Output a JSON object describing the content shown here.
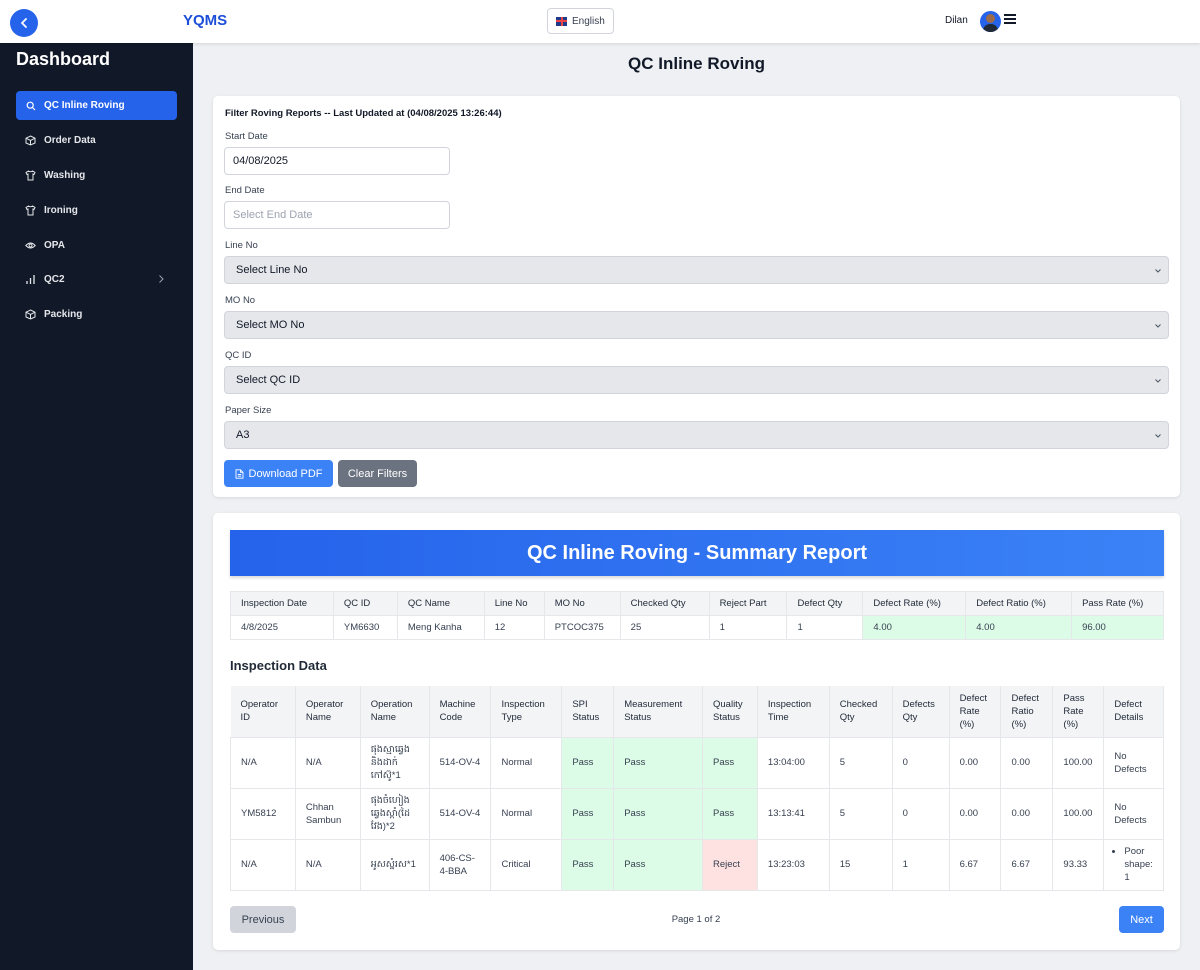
{
  "header": {
    "brand": "YQMS",
    "language": "English",
    "user_name": "Dilan"
  },
  "sidebar": {
    "title": "Dashboard",
    "items": [
      {
        "label": "QC Inline Roving",
        "icon": "search-icon",
        "active": true
      },
      {
        "label": "Order Data",
        "icon": "box-icon"
      },
      {
        "label": "Washing",
        "icon": "shirt-icon"
      },
      {
        "label": "Ironing",
        "icon": "shirt-icon"
      },
      {
        "label": "OPA",
        "icon": "eye-icon"
      },
      {
        "label": "QC2",
        "icon": "bar-chart-icon",
        "expandable": true
      },
      {
        "label": "Packing",
        "icon": "box-icon"
      }
    ]
  },
  "page": {
    "title": "QC Inline Roving"
  },
  "filters": {
    "heading": "Filter Roving Reports -- Last Updated at (04/08/2025 13:26:44)",
    "start_date_label": "Start Date",
    "start_date_value": "04/08/2025",
    "end_date_label": "End Date",
    "end_date_placeholder": "Select End Date",
    "line_no_label": "Line No",
    "line_no_value": "Select Line No",
    "mo_no_label": "MO No",
    "mo_no_value": "Select MO No",
    "qc_id_label": "QC ID",
    "qc_id_value": "Select QC ID",
    "paper_size_label": "Paper Size",
    "paper_size_value": "A3",
    "download_label": "Download PDF",
    "clear_label": "Clear Filters"
  },
  "report": {
    "title": "QC Inline Roving - Summary Report",
    "summary_headers": [
      "Inspection Date",
      "QC ID",
      "QC Name",
      "Line No",
      "MO No",
      "Checked Qty",
      "Reject Part",
      "Defect Qty",
      "Defect Rate (%)",
      "Defect Ratio (%)",
      "Pass Rate (%)"
    ],
    "summary_row": [
      "4/8/2025",
      "YM6630",
      "Meng Kanha",
      "12",
      "PTCOC375",
      "25",
      "1",
      "1",
      "4.00",
      "4.00",
      "96.00"
    ],
    "inspection_title": "Inspection Data",
    "inspection_headers": [
      "Operator ID",
      "Operator Name",
      "Operation Name",
      "Machine Code",
      "Inspection Type",
      "SPI Status",
      "Measurement Status",
      "Quality Status",
      "Inspection Time",
      "Checked Qty",
      "Defects Qty",
      "Defect Rate (%)",
      "Defect Ratio (%)",
      "Pass Rate (%)",
      "Defect Details"
    ],
    "inspection_rows": [
      [
        "N/A",
        "N/A",
        "ផុងស្មាឆ្វេងនិងដាក់កៅស៊ូ*1",
        "514-OV-4",
        "Normal",
        "Pass",
        "Pass",
        "Pass",
        "13:04:00",
        "5",
        "0",
        "0.00",
        "0.00",
        "100.00",
        "No Defects"
      ],
      [
        "YM5812",
        "Chhan Sambun",
        "ផុងចំហៀងឆ្វេងស្តាំ(ដៃវែង)*2",
        "514-OV-4",
        "Normal",
        "Pass",
        "Pass",
        "Pass",
        "13:13:41",
        "5",
        "0",
        "0.00",
        "0.00",
        "100.00",
        "No Defects"
      ],
      [
        "N/A",
        "N/A",
        "អូសស្នំរស*1",
        "406-CS-4-BBA",
        "Critical",
        "Pass",
        "Pass",
        "Reject",
        "13:23:03",
        "15",
        "1",
        "6.67",
        "6.67",
        "93.33",
        "Poor shape: 1"
      ]
    ],
    "prev_label": "Previous",
    "page_info": "Page 1 of 2",
    "next_label": "Next"
  },
  "colors": {
    "accent": "#2563eb",
    "sidebar_bg": "#111827",
    "pass_bg": "#dcfce7",
    "reject_bg": "#fee2e2"
  }
}
